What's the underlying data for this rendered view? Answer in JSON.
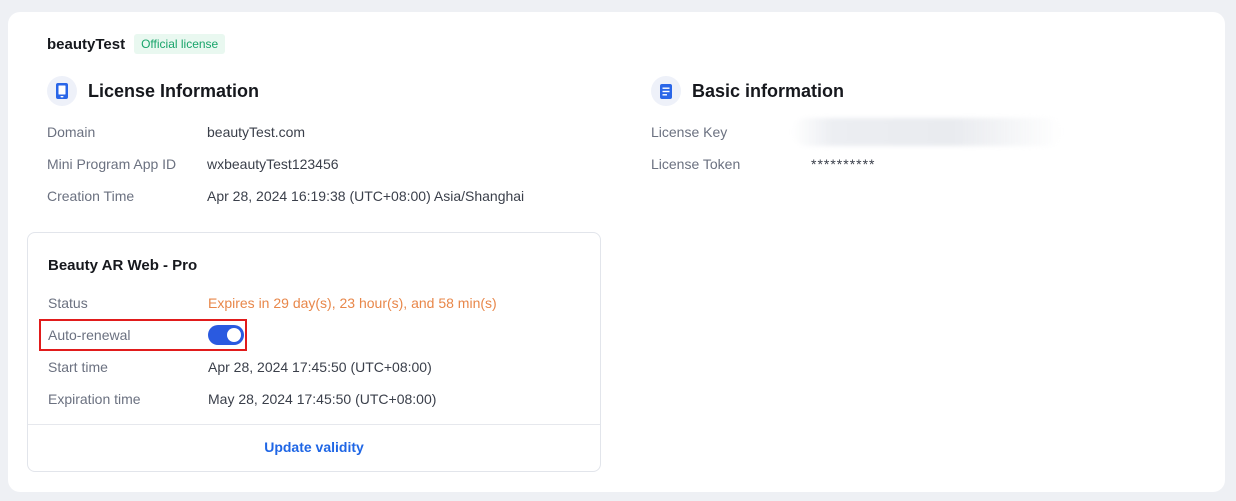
{
  "header": {
    "app_name": "beautyTest",
    "badge": "Official license"
  },
  "license_info": {
    "title": "License Information",
    "icon": "phone-icon",
    "rows": [
      {
        "label": "Domain",
        "value": "beautyTest.com"
      },
      {
        "label": "Mini Program App ID",
        "value": "wxbeautyTest123456"
      },
      {
        "label": "Creation Time",
        "value": "Apr 28, 2024 16:19:38 (UTC+08:00) Asia/Shanghai"
      }
    ]
  },
  "basic_info": {
    "title": "Basic information",
    "icon": "document-icon",
    "license_key_label": "License Key",
    "license_token_label": "License Token",
    "license_token_value": "**********"
  },
  "product": {
    "title": "Beauty AR Web - Pro",
    "status_label": "Status",
    "status_value": "Expires in 29 day(s), 23 hour(s), and 58 min(s)",
    "auto_renewal_label": "Auto-renewal",
    "auto_renewal_on": true,
    "start_label": "Start time",
    "start_value": "Apr 28, 2024 17:45:50 (UTC+08:00)",
    "expiration_label": "Expiration time",
    "expiration_value": "May 28, 2024 17:45:50 (UTC+08:00)",
    "update_link": "Update validity"
  },
  "colors": {
    "accent": "#1f66e5",
    "toggle_on": "#2a5ae0",
    "status_warning": "#e8874a",
    "badge_text": "#18a46a",
    "highlight": "#e11b1b"
  }
}
